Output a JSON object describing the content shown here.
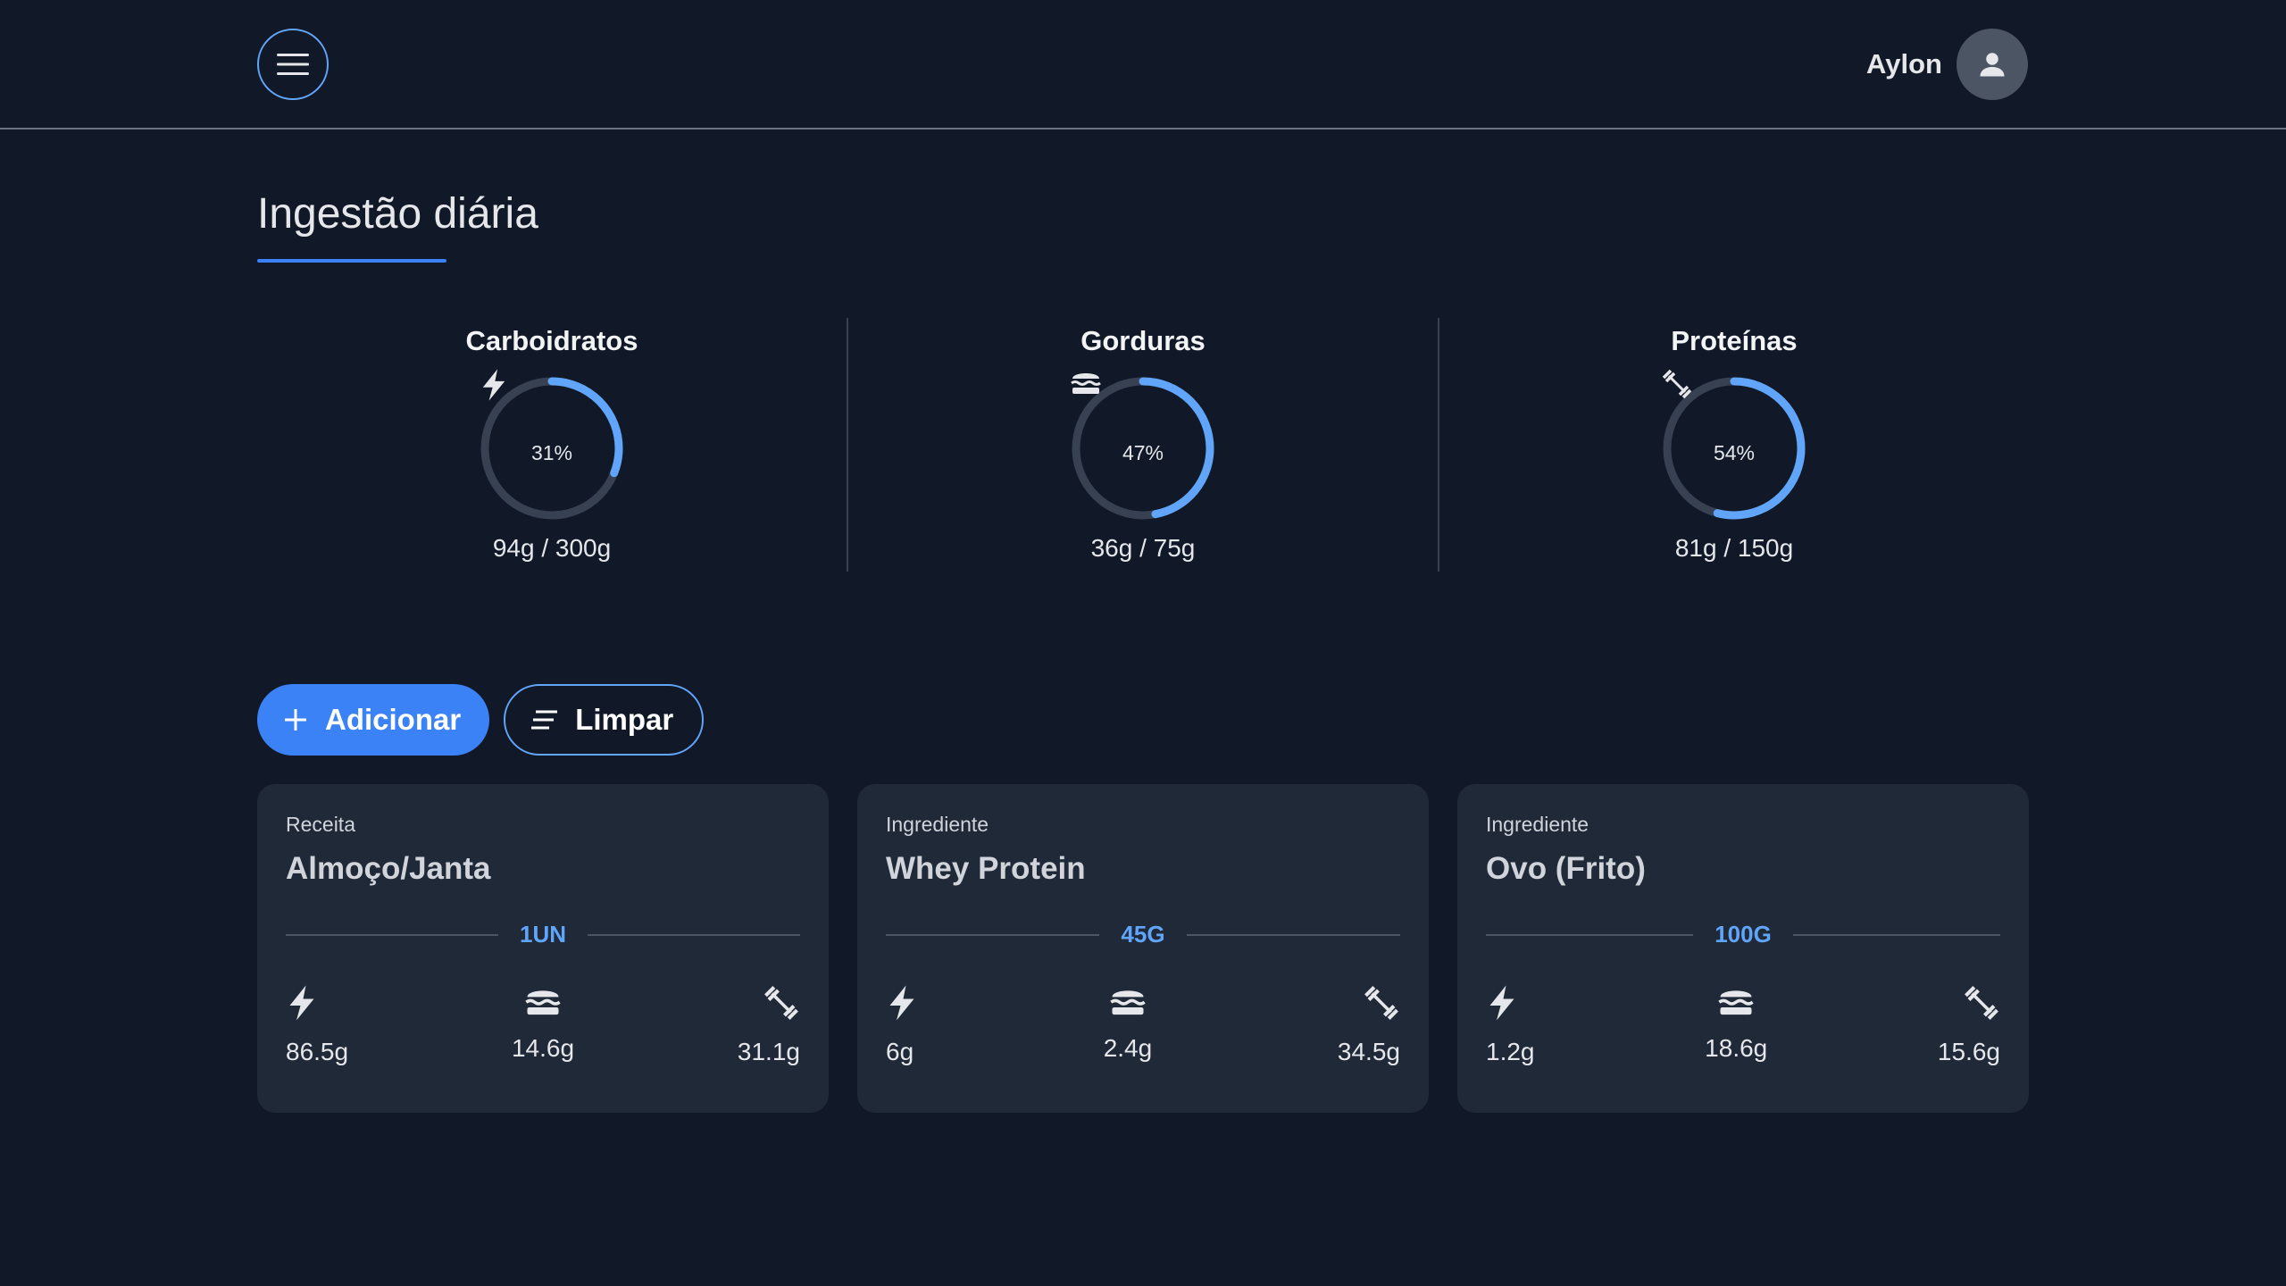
{
  "header": {
    "menu_icon": "hamburger-menu-icon",
    "user_name": "Aylon",
    "avatar_icon": "person-icon"
  },
  "page": {
    "title": "Ingestão diária"
  },
  "macros": [
    {
      "label": "Carboidratos",
      "icon": "lightning-icon",
      "percent_text": "31%",
      "percent": 31,
      "amount": "94g / 300g"
    },
    {
      "label": "Gorduras",
      "icon": "burger-icon",
      "percent_text": "47%",
      "percent": 47,
      "amount": "36g / 75g"
    },
    {
      "label": "Proteínas",
      "icon": "dumbbell-icon",
      "percent_text": "54%",
      "percent": 54,
      "amount": "81g / 150g"
    }
  ],
  "actions": {
    "add_label": "Adicionar",
    "add_icon": "plus-icon",
    "clear_label": "Limpar",
    "clear_icon": "sort-lines-icon"
  },
  "items": [
    {
      "type": "Receita",
      "name": "Almoço/Janta",
      "quantity": "1UN",
      "carbs": "86.5g",
      "fat": "14.6g",
      "protein": "31.1g"
    },
    {
      "type": "Ingrediente",
      "name": "Whey Protein",
      "quantity": "45G",
      "carbs": "6g",
      "fat": "2.4g",
      "protein": "34.5g"
    },
    {
      "type": "Ingrediente",
      "name": "Ovo (Frito)",
      "quantity": "100G",
      "carbs": "1.2g",
      "fat": "18.6g",
      "protein": "15.6g"
    }
  ],
  "colors": {
    "background": "#111827",
    "card": "#1f2937",
    "accent": "#3b82f6",
    "ring_track": "#374151",
    "ring_progress": "#60a5fa"
  }
}
